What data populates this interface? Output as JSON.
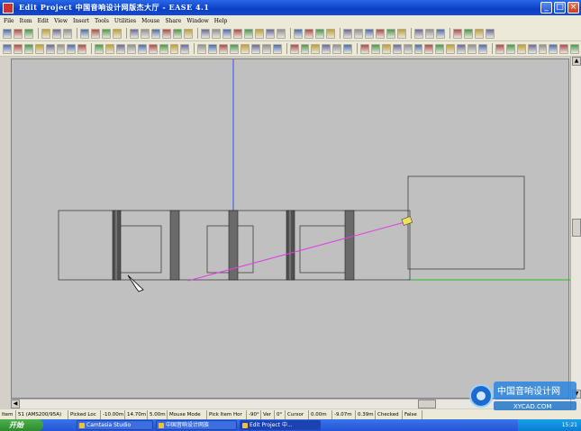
{
  "window": {
    "title": "Edit Project 中国音响设计网版杰大厅 - EASE 4.1",
    "controls": {
      "minimize": "_",
      "maximize": "□",
      "close": "×"
    }
  },
  "menu": [
    "File",
    "Item",
    "Edit",
    "View",
    "Insert",
    "Tools",
    "Utilities",
    "Mouse",
    "Share",
    "Window",
    "Help"
  ],
  "status": {
    "item": "Item",
    "name": "51 (AMS200/95A)",
    "mode": "Picked Loc",
    "x": "-10.00m",
    "y": "14.70m",
    "z": "5.00m",
    "mouse_mode": "Mouse Mode",
    "pick": "Pick Item Hor",
    "angle_hor": "-90°",
    "ver": "Ver",
    "angle_ver": "0°",
    "cursor": "Cursor",
    "cx": "0.00m",
    "cy": "-9.07m",
    "cz": "0.39m",
    "checked": "Checked",
    "checked_val": "False"
  },
  "taskbar": {
    "start": "开始",
    "tasks": [
      {
        "label": "Camtasia Studio",
        "active": false
      },
      {
        "label": "中国音响设计网族",
        "active": false
      },
      {
        "label": "Edit Project 中...",
        "active": true
      }
    ],
    "clock": "15:21"
  },
  "watermark": {
    "line1": "中国音响设计网",
    "line2": "XYCAD.COM"
  },
  "colors": {
    "canvas_bg": "#c0c0c0",
    "axis_vertical": "#3050ff",
    "axis_horizontal": "#20c020",
    "pick_ray": "#e040e0",
    "title_bar": "#0b3fc4"
  }
}
